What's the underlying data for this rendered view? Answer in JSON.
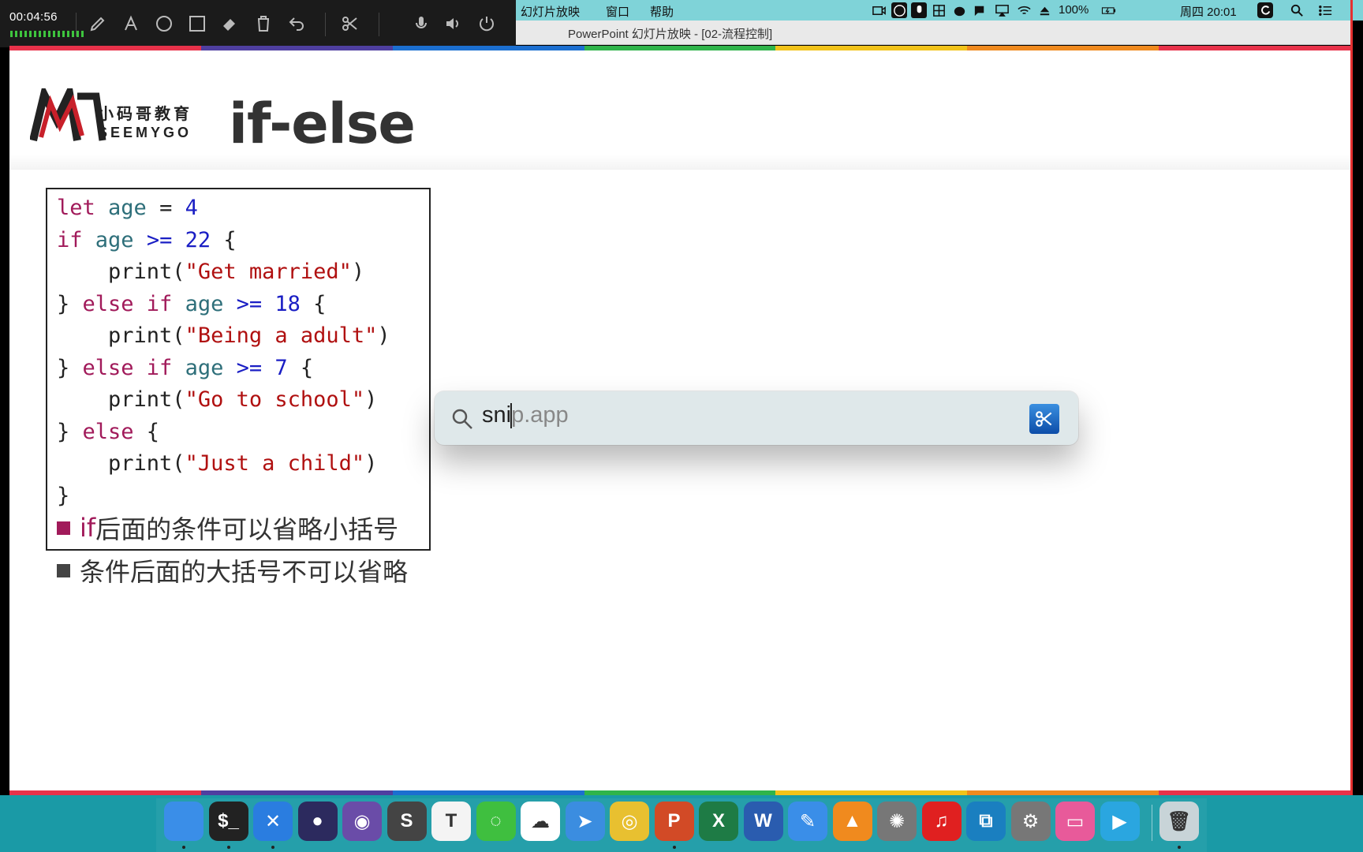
{
  "recorder": {
    "elapsed": "00:04:56",
    "tools": [
      "pen-icon",
      "text-icon",
      "circle-icon",
      "rectangle-icon",
      "eraser-icon",
      "trash-icon",
      "undo-icon",
      "scissors-icon",
      "microphone-icon",
      "speaker-icon",
      "power-icon"
    ]
  },
  "menubar": {
    "menus": [
      "幻灯片放映",
      "窗口",
      "帮助"
    ],
    "battery": "100%",
    "clock": "周四 20:01"
  },
  "window": {
    "title": "PowerPoint 幻灯片放映 - [02-流程控制]"
  },
  "slide": {
    "logo_cn": "小码哥教育",
    "logo_en": "SEEMYGO",
    "title": "if-else",
    "code": [
      [
        {
          "t": "let ",
          "c": "kw"
        },
        {
          "t": "age",
          "c": "var"
        },
        {
          "t": " = ",
          "c": "fn"
        },
        {
          "t": "4",
          "c": "num"
        }
      ],
      [
        {
          "t": "if ",
          "c": "kw"
        },
        {
          "t": "age",
          "c": "var"
        },
        {
          "t": " >= ",
          "c": "num"
        },
        {
          "t": "22",
          "c": "num"
        },
        {
          "t": " {",
          "c": "fn"
        }
      ],
      [
        {
          "t": "    print(",
          "c": "fn"
        },
        {
          "t": "\"Get married\"",
          "c": "str"
        },
        {
          "t": ")",
          "c": "fn"
        }
      ],
      [
        {
          "t": "} ",
          "c": "fn"
        },
        {
          "t": "else if ",
          "c": "kw"
        },
        {
          "t": "age",
          "c": "var"
        },
        {
          "t": " >= ",
          "c": "num"
        },
        {
          "t": "18",
          "c": "num"
        },
        {
          "t": " {",
          "c": "fn"
        }
      ],
      [
        {
          "t": "    print(",
          "c": "fn"
        },
        {
          "t": "\"Being a adult\"",
          "c": "str"
        },
        {
          "t": ")",
          "c": "fn"
        }
      ],
      [
        {
          "t": "} ",
          "c": "fn"
        },
        {
          "t": "else if ",
          "c": "kw"
        },
        {
          "t": "age",
          "c": "var"
        },
        {
          "t": " >= ",
          "c": "num"
        },
        {
          "t": "7",
          "c": "num"
        },
        {
          "t": " {",
          "c": "fn"
        }
      ],
      [
        {
          "t": "    print(",
          "c": "fn"
        },
        {
          "t": "\"Go to school\"",
          "c": "str"
        },
        {
          "t": ")",
          "c": "fn"
        }
      ],
      [
        {
          "t": "} ",
          "c": "fn"
        },
        {
          "t": "else",
          "c": "kw"
        },
        {
          "t": " {",
          "c": "fn"
        }
      ],
      [
        {
          "t": "    print(",
          "c": "fn"
        },
        {
          "t": "\"Just a child\"",
          "c": "str"
        },
        {
          "t": ")",
          "c": "fn"
        }
      ],
      [
        {
          "t": "}",
          "c": "fn"
        }
      ]
    ],
    "bullets": [
      {
        "accent": "if",
        "text": "后面的条件可以省略小括号",
        "color": "#a11a5a"
      },
      {
        "accent": "",
        "text": "条件后面的大括号不可以省略",
        "color": "#444444"
      }
    ]
  },
  "spotlight": {
    "typed": "sni",
    "suggestion": "p.app",
    "app_icon": "scissors-icon"
  },
  "dock": {
    "apps": [
      {
        "name": "finder",
        "color": "#3a8ee8",
        "glyph": ""
      },
      {
        "name": "terminal",
        "color": "#222",
        "glyph": "$_"
      },
      {
        "name": "xcode",
        "color": "#2a7de0",
        "glyph": "✕"
      },
      {
        "name": "eclipse",
        "color": "#2c2a5e",
        "glyph": "●"
      },
      {
        "name": "github",
        "color": "#6a4ca8",
        "glyph": "◉"
      },
      {
        "name": "sublime",
        "color": "#444",
        "glyph": "S"
      },
      {
        "name": "typora",
        "color": "#f4f4f4",
        "glyph": "T"
      },
      {
        "name": "wechat",
        "color": "#3fbf3f",
        "glyph": "◌"
      },
      {
        "name": "baidu-netdisk",
        "color": "#ffffff",
        "glyph": "☁"
      },
      {
        "name": "airmail",
        "color": "#3b8de0",
        "glyph": "➤"
      },
      {
        "name": "chrome",
        "color": "#e8c030",
        "glyph": "◎"
      },
      {
        "name": "powerpoint",
        "color": "#d24a26",
        "glyph": "P"
      },
      {
        "name": "excel",
        "color": "#1e7b45",
        "glyph": "X"
      },
      {
        "name": "word",
        "color": "#2a5caf",
        "glyph": "W"
      },
      {
        "name": "pen-tool",
        "color": "#3a8ee8",
        "glyph": "✎"
      },
      {
        "name": "vlc",
        "color": "#f08a1e",
        "glyph": "▲"
      },
      {
        "name": "photo-slideshow",
        "color": "#777",
        "glyph": "✺"
      },
      {
        "name": "netease-music",
        "color": "#e02020",
        "glyph": "♫"
      },
      {
        "name": "vmware",
        "color": "#1a7fc0",
        "glyph": "⧉"
      },
      {
        "name": "system-preferences",
        "color": "#777",
        "glyph": "⚙"
      },
      {
        "name": "cleanmymac",
        "color": "#e85a9a",
        "glyph": "▭"
      },
      {
        "name": "screenflow",
        "color": "#2aa6e0",
        "glyph": "▶"
      },
      {
        "name": "trash",
        "color": "#c8d4d8",
        "glyph": "🗑"
      }
    ]
  },
  "colors": {
    "stripe": [
      "#e8324a",
      "#4f3fa0",
      "#1c6fd0",
      "#2fb44a",
      "#f2c31a",
      "#f08a1e",
      "#e8324a"
    ]
  }
}
